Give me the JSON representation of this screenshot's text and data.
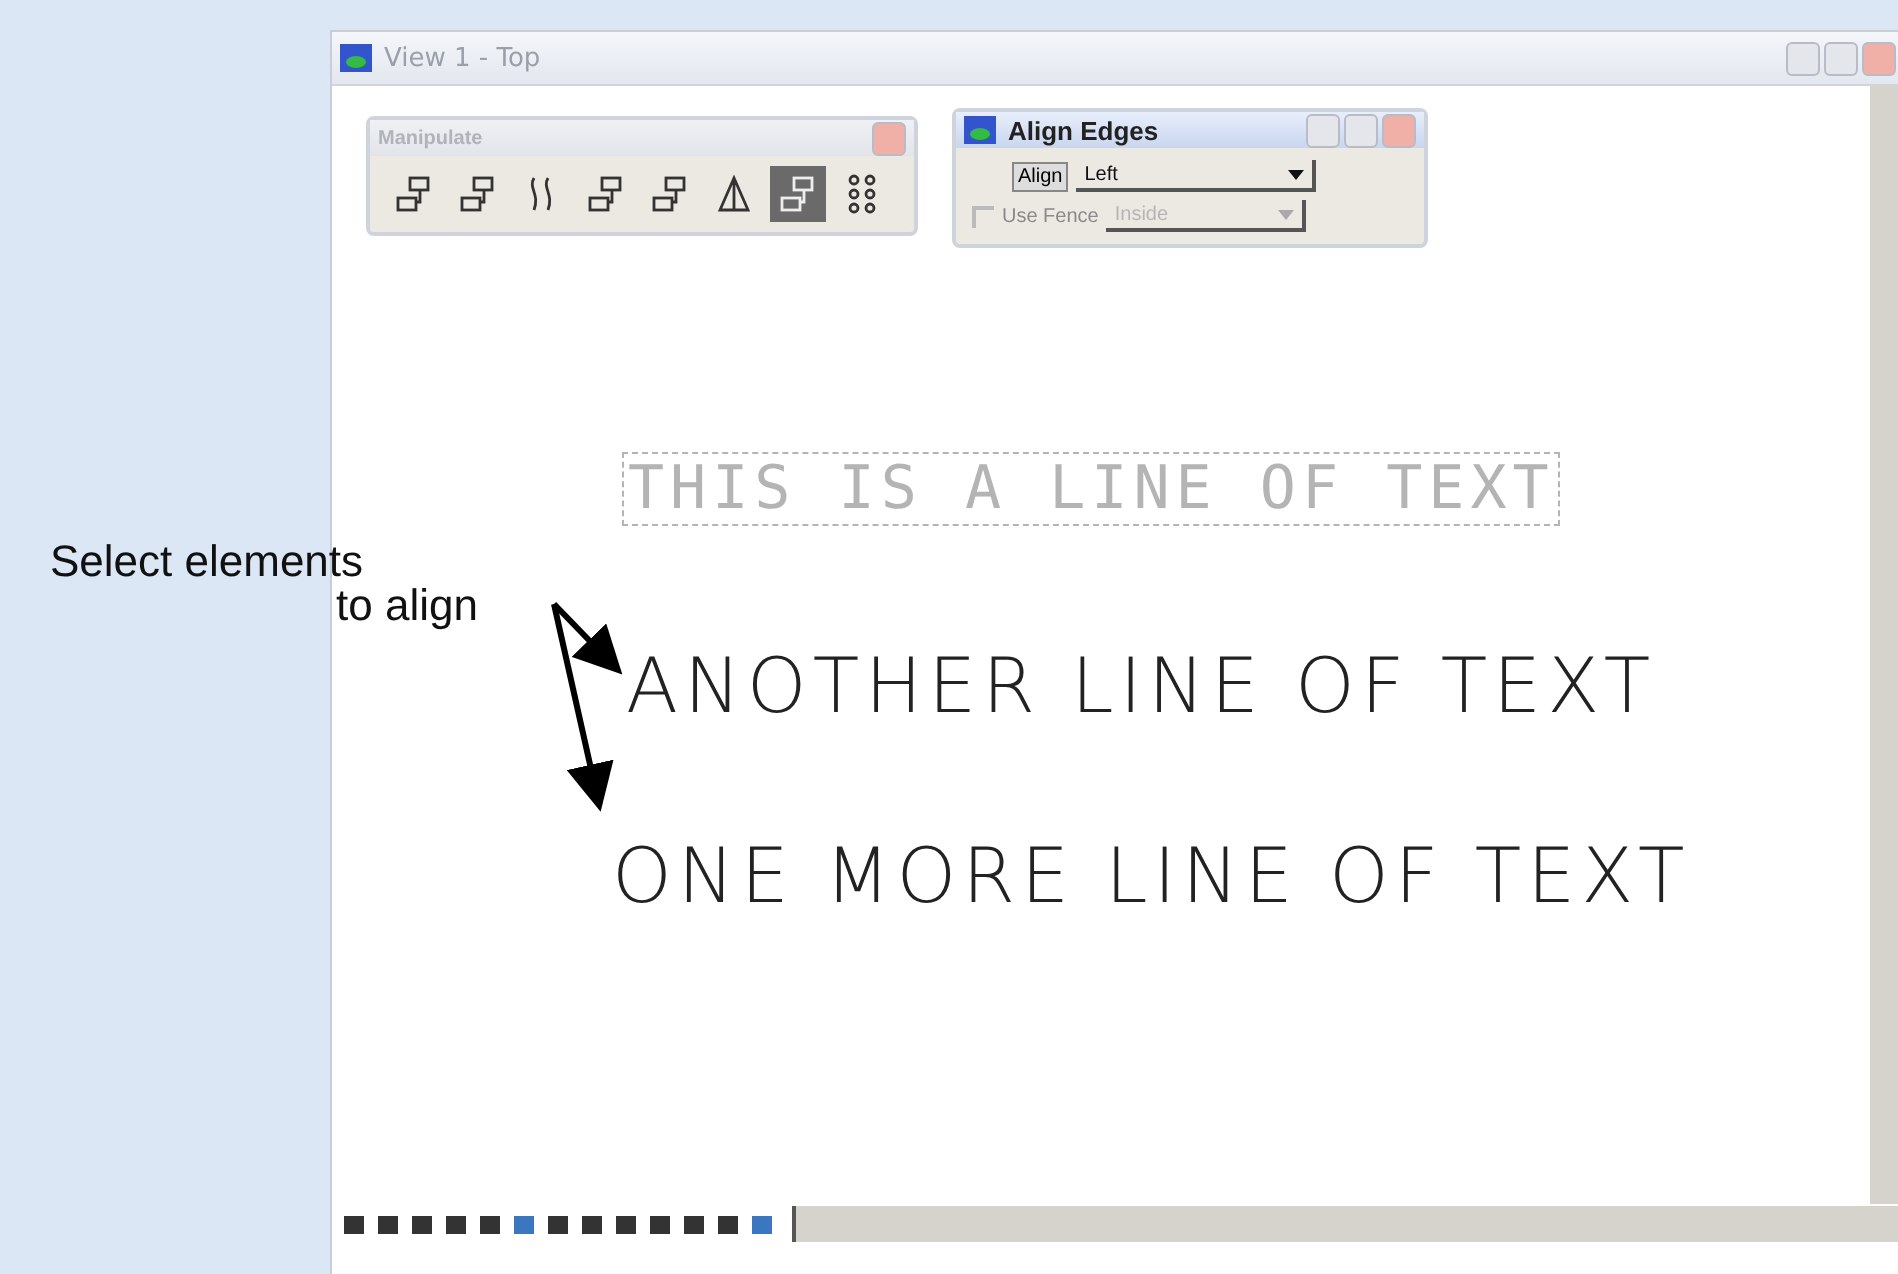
{
  "window": {
    "title": "View 1 - Top"
  },
  "manipulate_palette": {
    "title": "Manipulate",
    "tools": [
      {
        "selected": false
      },
      {
        "selected": false
      },
      {
        "selected": false
      },
      {
        "selected": false
      },
      {
        "selected": false
      },
      {
        "selected": false
      },
      {
        "selected": true
      },
      {
        "selected": false
      }
    ]
  },
  "align_edges": {
    "title": "Align Edges",
    "align_button": "Align",
    "align_value": "Left",
    "use_fence": {
      "label": "Use Fence",
      "checked": false,
      "disabled": true
    },
    "fence_mode": "Inside"
  },
  "canvas_text": [
    {
      "text": "THIS IS A LINE OF TEXT",
      "selected": true
    },
    {
      "text": "ANOTHER LINE OF TEXT",
      "selected": false
    },
    {
      "text": "ONE MORE LINE OF TEXT",
      "selected": false
    }
  ],
  "callout": [
    "Select elements",
    "to align"
  ]
}
